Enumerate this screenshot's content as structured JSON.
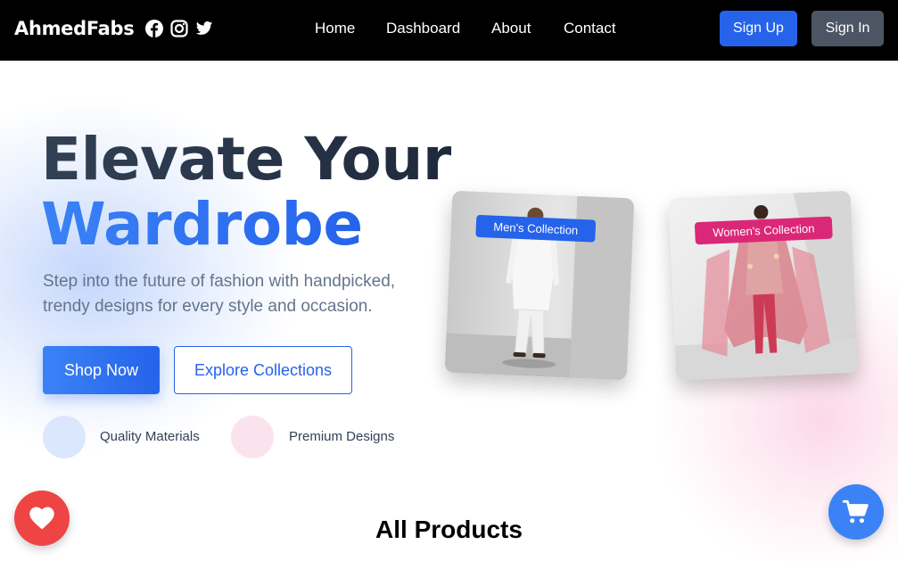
{
  "navbar": {
    "brand": "AhmedFabs",
    "social_icons": [
      "facebook-icon",
      "instagram-icon",
      "twitter-icon"
    ],
    "links": [
      "Home",
      "Dashboard",
      "About",
      "Contact"
    ],
    "signup_label": "Sign Up",
    "signin_label": "Sign In"
  },
  "hero": {
    "headline_line1": "Elevate Your",
    "headline_line2": "Wardrobe",
    "subtext": "Step into the future of fashion with handpicked, trendy designs for every style and occasion.",
    "shop_label": "Shop Now",
    "explore_label": "Explore Collections",
    "features": [
      "Quality Materials",
      "Premium Designs"
    ],
    "cards": {
      "men_tag": "Men's Collection",
      "women_tag": "Women's Collection"
    }
  },
  "products": {
    "title": "All Products"
  },
  "floating": {
    "wishlist_icon": "heart-icon",
    "cart_icon": "cart-icon"
  },
  "colors": {
    "primary": "#2563eb",
    "secondary": "#4b5563",
    "pink_accent": "#db2777",
    "heart_red": "#ef4444"
  }
}
